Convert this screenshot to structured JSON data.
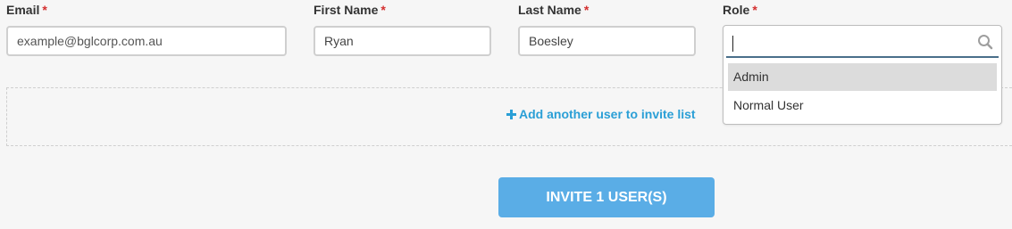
{
  "form": {
    "email": {
      "label": "Email",
      "required_mark": "*",
      "placeholder": "example@bglcorp.com.au",
      "value": ""
    },
    "first_name": {
      "label": "First Name",
      "required_mark": "*",
      "value": "Ryan"
    },
    "last_name": {
      "label": "Last Name",
      "required_mark": "*",
      "value": "Boesley"
    },
    "role": {
      "label": "Role",
      "required_mark": "*",
      "search_value": "",
      "options": [
        {
          "label": "Admin",
          "highlighted": true
        },
        {
          "label": "Normal User",
          "highlighted": false
        }
      ]
    }
  },
  "add_another": {
    "icon": "plus-icon",
    "label": "Add another user to invite list"
  },
  "invite_button": {
    "label": "INVITE 1 USER(S)"
  },
  "colors": {
    "required": "#d32f2f",
    "link": "#2a9fd6",
    "button": "#5aade6",
    "highlight": "#dcdcdc",
    "search_underline": "#4a6f8a"
  },
  "icons": {
    "role_search": "search-icon"
  }
}
